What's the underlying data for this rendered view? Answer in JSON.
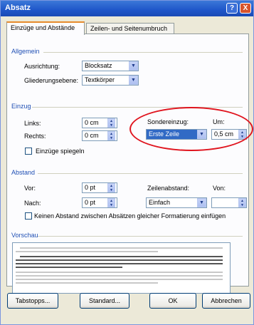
{
  "window": {
    "title": "Absatz",
    "help_glyph": "?",
    "close_glyph": "X"
  },
  "tabs": [
    {
      "label": "Einzüge und Abstände"
    },
    {
      "label": "Zeilen- und Seitenumbruch"
    }
  ],
  "general": {
    "heading": "Allgemein",
    "alignment_label": "Ausrichtung:",
    "alignment_value": "Blocksatz",
    "outline_label": "Gliederungsebene:",
    "outline_value": "Textkörper"
  },
  "indent": {
    "heading": "Einzug",
    "left_label": "Links:",
    "left_value": "0 cm",
    "right_label": "Rechts:",
    "right_value": "0 cm",
    "special_label": "Sondereinzug:",
    "special_value": "Erste Zeile",
    "by_label": "Um:",
    "by_value": "0,5 cm",
    "mirror_label": "Einzüge spiegeln"
  },
  "spacing": {
    "heading": "Abstand",
    "before_label": "Vor:",
    "before_value": "0 pt",
    "after_label": "Nach:",
    "after_value": "0 pt",
    "line_label": "Zeilenabstand:",
    "line_value": "Einfach",
    "at_label": "Von:",
    "at_value": "",
    "no_space_label": "Keinen Abstand zwischen Absätzen gleicher Formatierung einfügen"
  },
  "preview": {
    "heading": "Vorschau"
  },
  "buttons": {
    "tabs": "Tabstopps...",
    "default": "Standard...",
    "ok": "OK",
    "cancel": "Abbrechen"
  },
  "colors": {
    "section_heading": "#1f4fb4",
    "highlight_ellipse": "#e0141e",
    "title_bar": "#1f56c9"
  }
}
